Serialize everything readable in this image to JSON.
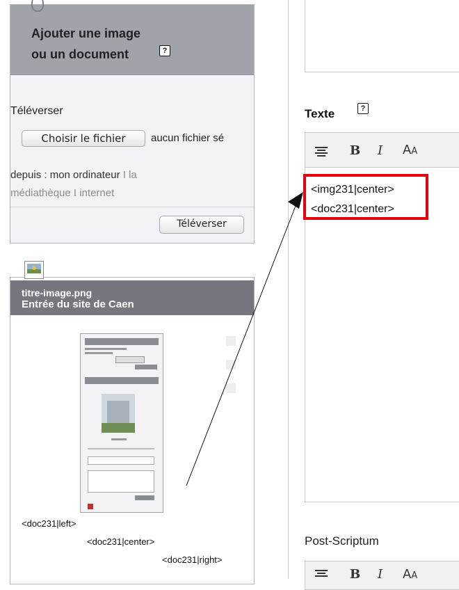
{
  "upload_panel": {
    "title_line1": "Ajouter une image",
    "title_line2": "ou un document",
    "help": "?",
    "upload_label": "Téléverser",
    "choose_file_button": "Choisir le fichier",
    "no_file_text": "aucun fichier sé",
    "from_label": "depuis : mon ordinateur",
    "sep1": "I",
    "link_library_1": "la",
    "link_library_2": "médiathèque",
    "sep2": "I",
    "link_internet": "internet",
    "submit_button": "Téléverser"
  },
  "doc_card": {
    "filename": "titre-image.png",
    "caption": "Entrée du site de Caen",
    "shortcodes": [
      "<doc231|left>",
      "<doc231|center>",
      "<doc231|right>"
    ]
  },
  "editor": {
    "texte_label": "Texte",
    "help": "?",
    "content_lines": [
      "<img231|center>",
      "<doc231|center>"
    ],
    "postscriptum_label": "Post-Scriptum"
  },
  "icons": {
    "align": "align-icon",
    "bold": "bold-icon",
    "italic": "italic-icon",
    "font_size": "font-size-icon"
  },
  "colors": {
    "panel_header": "#a0a4aa",
    "panel_body": "#f1f3f6",
    "highlight": "#e8000f",
    "link": "#8d8d8d"
  }
}
